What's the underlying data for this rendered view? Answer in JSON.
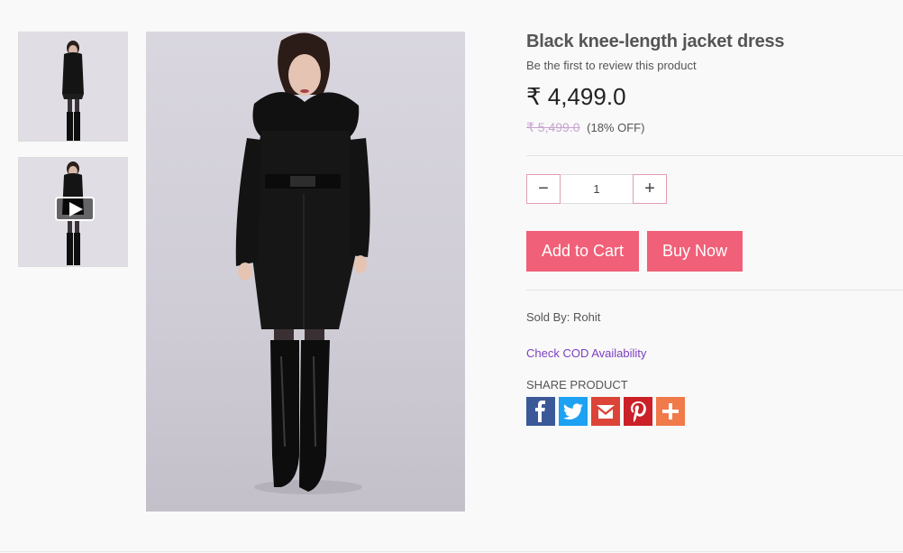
{
  "gallery": {
    "thumbnails": [
      {
        "icon": "product-photo",
        "video": false
      },
      {
        "icon": "product-photo",
        "video": true
      }
    ],
    "play_icon": "play-icon"
  },
  "product": {
    "title": "Black knee-length jacket dress",
    "review_text": "Be the first to review this product",
    "currency_symbol": "₹",
    "price": "4,499.0",
    "mrp": "₹ 5,499.0",
    "discount": "(18% OFF)",
    "quantity": "1",
    "sold_by": "Sold By: Rohit",
    "cod_link": "Check COD Availability",
    "share_label": "SHARE PRODUCT"
  },
  "buttons": {
    "decrease": "−",
    "increase": "+",
    "add_to_cart": "Add to Cart",
    "buy_now": "Buy Now"
  },
  "share": [
    {
      "name": "facebook-icon",
      "glyph": "f",
      "color": "#3b5998"
    },
    {
      "name": "twitter-icon",
      "glyph": "t",
      "color": "#1da1f2"
    },
    {
      "name": "gmail-icon",
      "glyph": "M",
      "color": "#db4437"
    },
    {
      "name": "pinterest-icon",
      "glyph": "P",
      "color": "#cb2027"
    },
    {
      "name": "more-share-icon",
      "glyph": "+",
      "color": "#f07a4a"
    }
  ],
  "colors": {
    "accent": "#f06078",
    "link": "#7b3fbf",
    "strike": "#c9a4cf"
  }
}
